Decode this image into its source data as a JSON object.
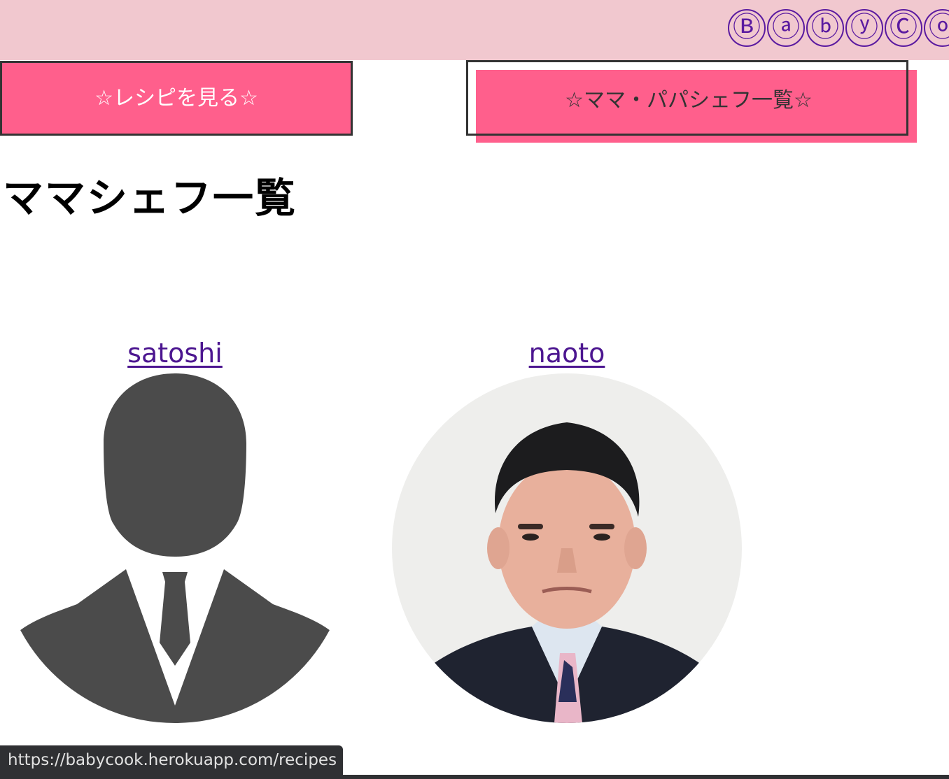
{
  "header": {
    "logo_chars": [
      "Ⓑ",
      "ⓐ",
      "ⓑ",
      "ⓨ",
      "Ⓒ",
      "ⓞ"
    ],
    "background": "#f1c8cf",
    "logo_color": "#5a1aa0"
  },
  "nav": {
    "recipes_label": "☆レシピを見る☆",
    "chefs_label": "☆ママ・パパシェフ一覧☆",
    "accent": "#ff5f8c"
  },
  "main": {
    "title": "ママシェフ一覧",
    "chefs": [
      {
        "name": "satoshi",
        "avatar_icon": "person-silhouette-icon"
      },
      {
        "name": "naoto",
        "avatar_icon": "profile-photo"
      }
    ]
  },
  "status": {
    "url": "https://babycook.herokuapp.com/recipes"
  }
}
